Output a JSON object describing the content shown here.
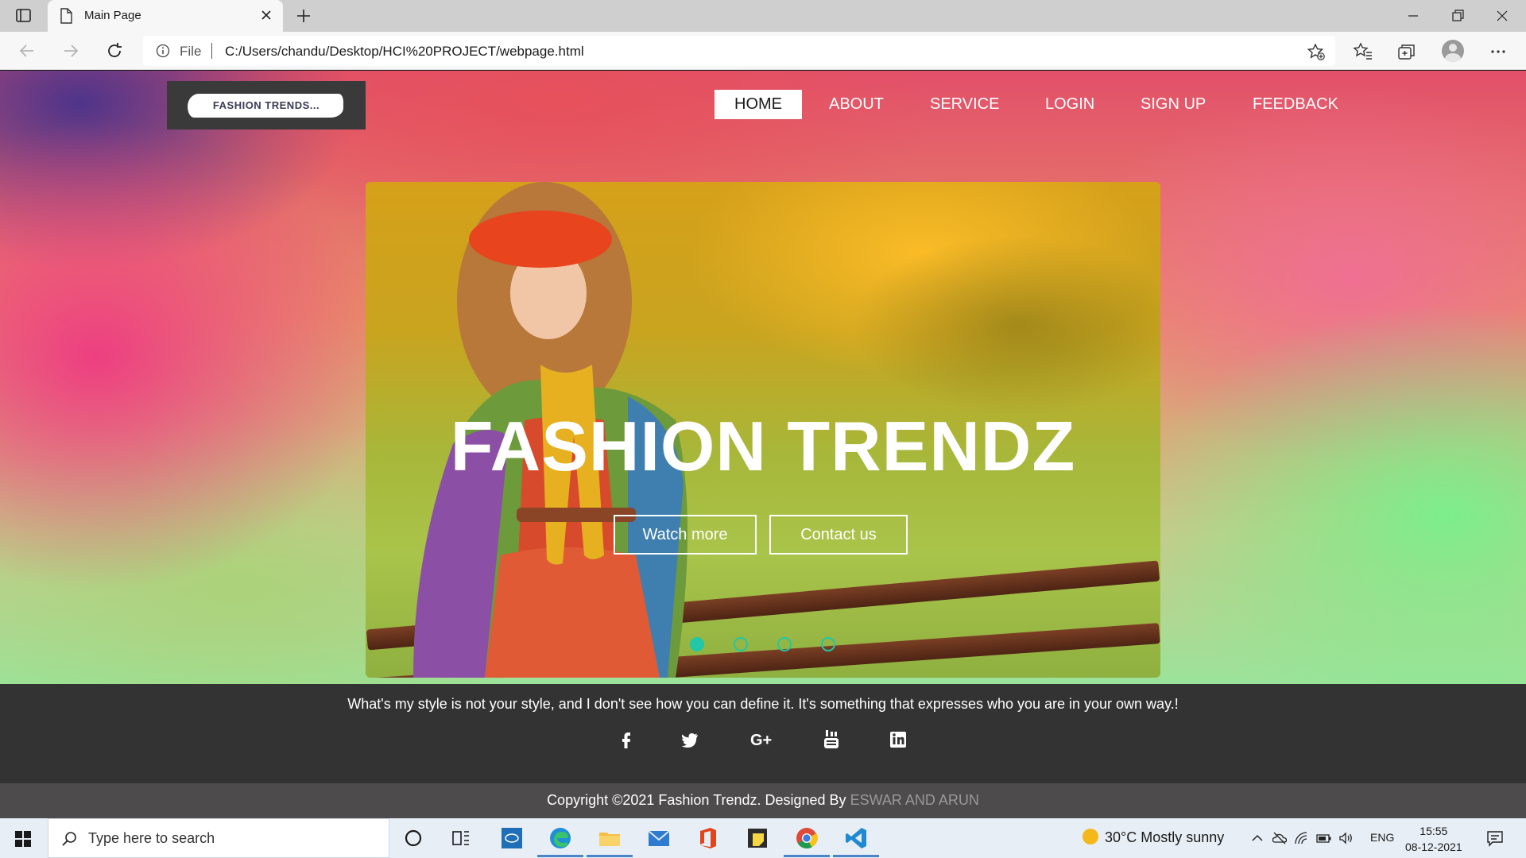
{
  "browser": {
    "tab_title": "Main Page",
    "address": {
      "scheme_label": "File",
      "url": "C:/Users/chandu/Desktop/HCI%20PROJECT/webpage.html"
    }
  },
  "site": {
    "logo_text": "FASHION TRENDS...",
    "nav": [
      "HOME",
      "ABOUT",
      "SERVICE",
      "LOGIN",
      "SIGN UP",
      "FEEDBACK"
    ],
    "active_nav": "HOME",
    "hero": {
      "title": "FASHION TRENDZ",
      "buttons": [
        "Watch more",
        "Contact us"
      ],
      "slides_total": 4,
      "active_slide": 1
    },
    "footer": {
      "quote": "What's my style is not your style, and I don't see how you can define it. It's something that expresses who you are in your own way.!",
      "social_icons": [
        "facebook-icon",
        "twitter-icon",
        "google-plus-icon",
        "youtube-icon",
        "linkedin-icon"
      ],
      "copyright_prefix": "Copyright ©2021 Fashion Trendz. Designed By",
      "designers": "ESWAR AND ARUN"
    }
  },
  "taskbar": {
    "search_placeholder": "Type here to search",
    "weather": "30°C  Mostly sunny",
    "language": "ENG",
    "time": "15:55",
    "date": "08-12-2021"
  },
  "colors": {
    "accent_dot": "#21c7a7",
    "footer_dark": "#333333",
    "footer_bottom": "#4d4b4c",
    "designers_text": "#9a9a9a"
  }
}
